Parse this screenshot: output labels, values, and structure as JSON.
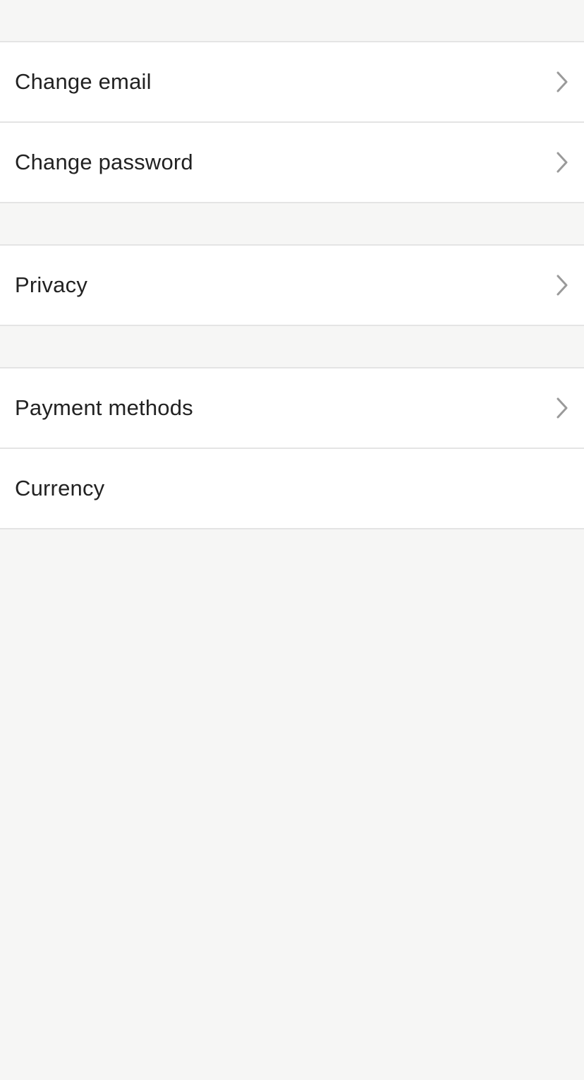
{
  "settings": {
    "groups": [
      {
        "items": [
          {
            "label": "Change email",
            "icon": "chevron-right-icon"
          },
          {
            "label": "Change password",
            "icon": "chevron-right-icon"
          }
        ]
      },
      {
        "items": [
          {
            "label": "Privacy",
            "icon": "chevron-right-icon"
          }
        ]
      },
      {
        "items": [
          {
            "label": "Payment methods",
            "icon": "chevron-right-icon"
          },
          {
            "label": "Currency"
          }
        ]
      }
    ]
  },
  "colors": {
    "background": "#f6f6f5",
    "row_background": "#ffffff",
    "divider": "#e4e4e4",
    "text": "#222222",
    "chevron": "#9a9a9a"
  }
}
